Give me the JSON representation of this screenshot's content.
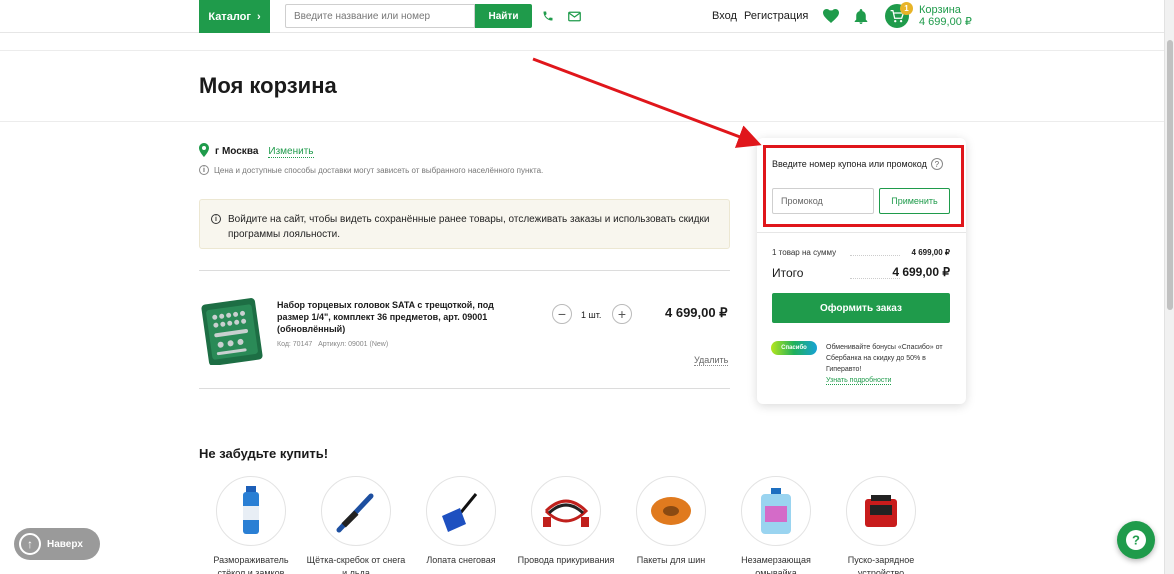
{
  "header": {
    "catalog_label": "Каталог",
    "search_placeholder": "Введите название или номер",
    "search_button": "Найти",
    "login": "Вход",
    "register": "Регистрация",
    "cart_label": "Корзина",
    "cart_total": "4 699,00 ₽",
    "cart_count": "1"
  },
  "page": {
    "title": "Моя корзина"
  },
  "location": {
    "city": "г Москва",
    "change": "Изменить",
    "note": "Цена и доступные способы доставки могут зависеть от выбранного населённого пункта."
  },
  "notice": {
    "text": "Войдите на сайт, чтобы видеть сохранённые ранее товары, отслеживать заказы и использовать скидки программы лояльности."
  },
  "cart_item": {
    "name": "Набор торцевых головок SATA с трещоткой, под размер 1/4\", комплект 36 предметов, арт. 09001 (обновлённый)",
    "code": "Код: 70147",
    "article": "Артикул: 09001 (New)",
    "qty": "1 шт.",
    "price": "4 699,00 ₽",
    "delete": "Удалить"
  },
  "summary": {
    "promo_label": "Введите номер купона или промокод",
    "promo_placeholder": "Промокод",
    "apply": "Применить",
    "items_label": "1 товар на сумму",
    "items_value": "4 699,00 ₽",
    "total_label": "Итого",
    "total_value": "4 699,00 ₽",
    "checkout": "Оформить заказ",
    "spasibo_logo": "Спасибо",
    "spasibo_text": "Обменивайте бонусы «Спасибо» от Сбербанка на скидку до 50% в Гиперавто!",
    "spasibo_link": "Узнать подробности"
  },
  "recommendations": {
    "title": "Не забудьте купить!",
    "items": [
      {
        "label": "Размораживатель стёкол и замков"
      },
      {
        "label": "Щётка-скребок от снега и льда"
      },
      {
        "label": "Лопата снеговая"
      },
      {
        "label": "Провода прикуривания"
      },
      {
        "label": "Пакеты для шин"
      },
      {
        "label": "Незамерзающая омывайка"
      },
      {
        "label": "Пуско-зарядное устройство"
      }
    ]
  },
  "back_to_top": "Наверх",
  "colors": {
    "brand_green": "#1f9b4b",
    "highlight_red": "#e0161b"
  }
}
